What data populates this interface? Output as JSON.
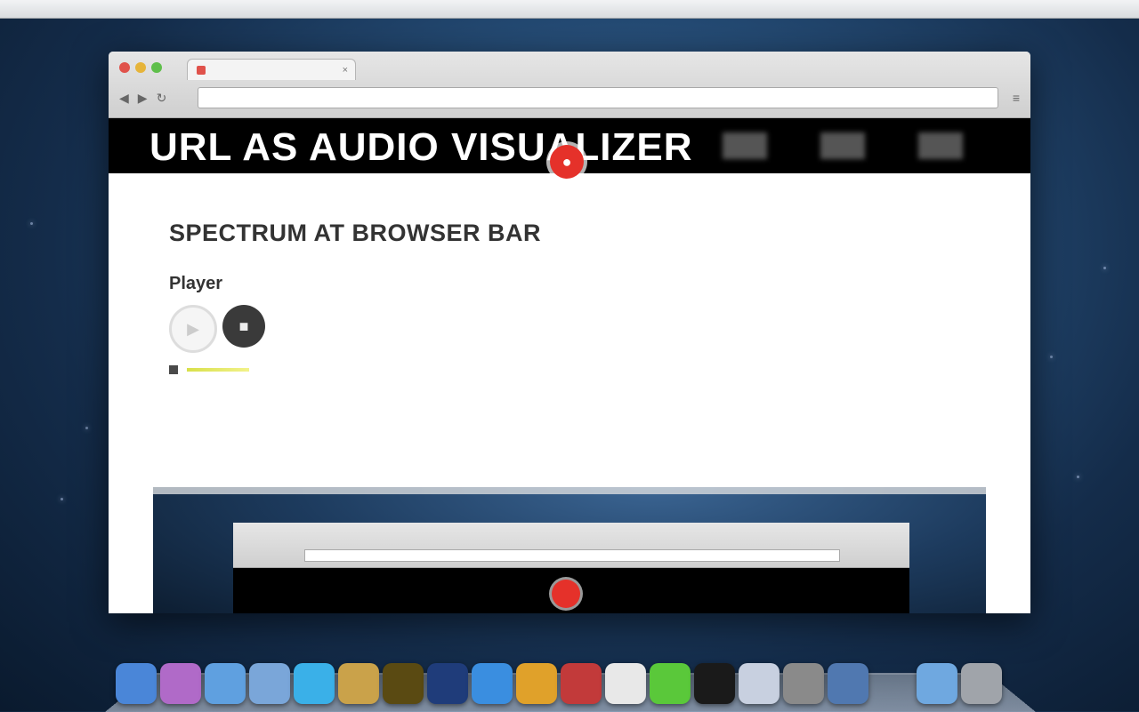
{
  "menubar": {
    "items": "",
    "status": ""
  },
  "browser": {
    "tab_title": "",
    "url": "",
    "nav": {
      "back": "◀",
      "forward": "▶",
      "reload": "↻"
    },
    "wrench": "≡"
  },
  "page": {
    "banner_title": "URL AS AUDIO VISUALIZER",
    "heading": "SPECTRUM AT BROWSER BAR",
    "description": "",
    "player_label": "Player",
    "play_symbol": "▶",
    "stop_symbol": "■",
    "status_text": "",
    "note": ""
  },
  "dock": {
    "icons": [
      {
        "name": "finder-icon",
        "color": "#4a86d8"
      },
      {
        "name": "launchpad-icon",
        "color": "#b06ac8"
      },
      {
        "name": "safari-icon",
        "color": "#5fa0e0"
      },
      {
        "name": "mail-icon",
        "color": "#7aa6d9"
      },
      {
        "name": "skype-icon",
        "color": "#3ab0e8"
      },
      {
        "name": "iphoto-icon",
        "color": "#caa24a"
      },
      {
        "name": "illustrator-icon",
        "color": "#5a4a12"
      },
      {
        "name": "photoshop-icon",
        "color": "#1f3c7a"
      },
      {
        "name": "app-store-icon",
        "color": "#3a8ee0"
      },
      {
        "name": "chrome-icon",
        "color": "#e0a12a"
      },
      {
        "name": "folder-icon",
        "color": "#c23a3a"
      },
      {
        "name": "preview-icon",
        "color": "#e8e8e8"
      },
      {
        "name": "messages-icon",
        "color": "#5ac83a"
      },
      {
        "name": "terminal-icon",
        "color": "#1a1a1a"
      },
      {
        "name": "text-edit-icon",
        "color": "#c8d0e0"
      },
      {
        "name": "system-preferences-icon",
        "color": "#8a8a8a"
      },
      {
        "name": "network-icon",
        "color": "#5078b0"
      },
      {
        "name": "spacer-icon",
        "color": "transparent"
      },
      {
        "name": "downloads-folder-icon",
        "color": "#6fa8e0"
      },
      {
        "name": "trash-icon",
        "color": "#a0a4aa"
      }
    ]
  }
}
